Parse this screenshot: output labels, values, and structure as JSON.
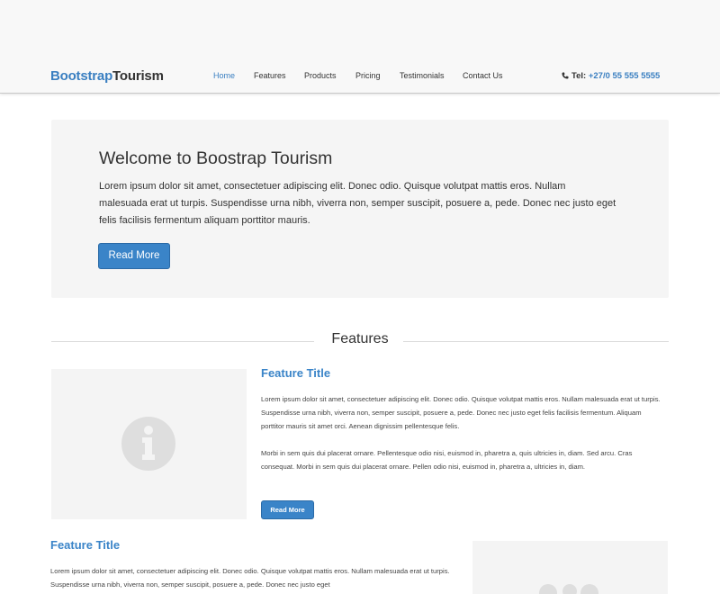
{
  "header": {
    "brand_part1": "Bootstrap",
    "brand_part2": "Tourism",
    "nav": [
      {
        "label": "Home",
        "active": true
      },
      {
        "label": "Features",
        "active": false
      },
      {
        "label": "Products",
        "active": false
      },
      {
        "label": "Pricing",
        "active": false
      },
      {
        "label": "Testimonials",
        "active": false
      },
      {
        "label": "Contact Us",
        "active": false
      }
    ],
    "phone_label": "Tel:",
    "phone_number": "+27/0 55 555 5555",
    "phone_icon": "phone-icon"
  },
  "jumbotron": {
    "title": "Welcome to Boostrap Tourism",
    "text": "Lorem ipsum dolor sit amet, consectetuer adipiscing elit. Donec odio. Quisque volutpat mattis eros. Nullam malesuada erat ut turpis. Suspendisse urna nibh, viverra non, semper suscipit, posuere a, pede. Donec nec justo eget felis facilisis fermentum aliquam porttitor mauris.",
    "button": "Read More"
  },
  "features": {
    "section_title": "Features",
    "items": [
      {
        "title": "Feature Title",
        "para1": "Lorem ipsum dolor sit amet, consectetuer adipiscing elit. Donec odio. Quisque volutpat mattis eros. Nullam malesuada erat ut turpis. Suspendisse urna nibh, viverra non, semper suscipit, posuere a, pede. Donec nec justo eget felis facilisis fermentum. Aliquam porttitor mauris sit amet orci. Aenean dignissim pellentesque felis.",
        "para2": "Morbi in sem quis dui placerat ornare. Pellentesque odio nisi, euismod in, pharetra a, quis ultricies in, diam. Sed arcu. Cras consequat. Morbi in sem quis dui placerat ornare. Pellen odio nisi, euismod in, pharetra a, ultricies in, diam.",
        "button": "Read More",
        "image_icon": "info-icon"
      },
      {
        "title": "Feature Title",
        "para1": "Lorem ipsum dolor sit amet, consectetuer adipiscing elit. Donec odio. Quisque volutpat mattis eros. Nullam malesuada erat ut turpis. Suspendisse urna nibh, viverra non, semper suscipit, posuere a, pede. Donec nec justo eget",
        "image_icon": "users-icon"
      }
    ]
  },
  "colors": {
    "accent": "#3a84c8",
    "header_bg": "#f8f8f8",
    "panel_bg": "#f5f5f5"
  }
}
